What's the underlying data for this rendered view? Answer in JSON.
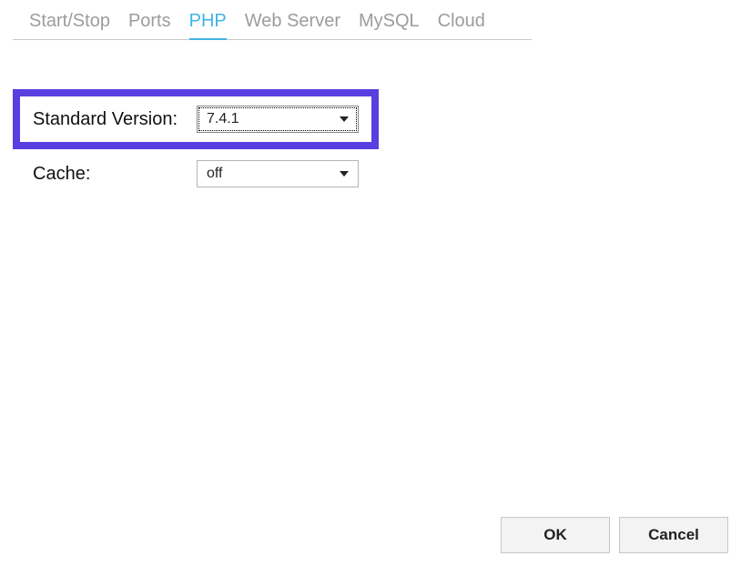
{
  "tabs": {
    "items": [
      {
        "label": "Start/Stop",
        "active": false
      },
      {
        "label": "Ports",
        "active": false
      },
      {
        "label": "PHP",
        "active": true
      },
      {
        "label": "Web Server",
        "active": false
      },
      {
        "label": "MySQL",
        "active": false
      },
      {
        "label": "Cloud",
        "active": false
      }
    ]
  },
  "form": {
    "standard_version": {
      "label": "Standard Version:",
      "value": "7.4.1"
    },
    "cache": {
      "label": "Cache:",
      "value": "off"
    }
  },
  "buttons": {
    "ok": "OK",
    "cancel": "Cancel"
  }
}
